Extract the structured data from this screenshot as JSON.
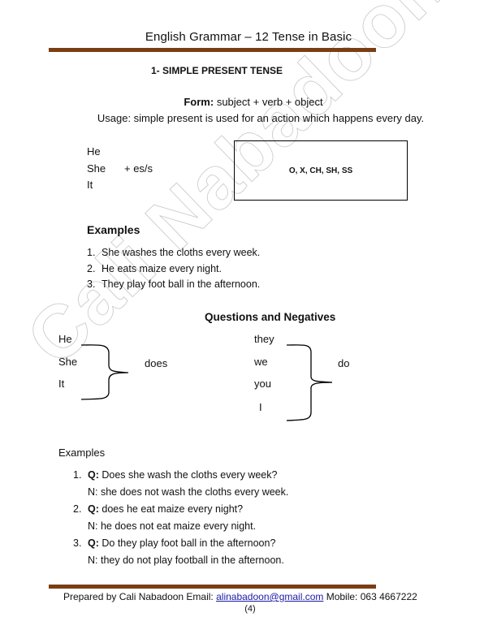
{
  "header": {
    "title": "English Grammar – 12 Tense in Basic"
  },
  "section": {
    "title": "1- SIMPLE PRESENT TENSE",
    "form_label": "Form:",
    "form_text": " subject + verb + object",
    "usage_text": "Usage: simple present is used for an action which happens every day."
  },
  "rule": {
    "pronouns": [
      "He",
      "She",
      "It"
    ],
    "suffix": "+ es/s",
    "endings_box": "O, X, CH, SH, SS"
  },
  "examples": {
    "heading": "Examples",
    "items": [
      {
        "num": "1.",
        "text": "She washes the cloths every week."
      },
      {
        "num": "2.",
        "text": "He eats maize every night."
      },
      {
        "num": "3.",
        "text": "They play foot ball in the afternoon."
      }
    ]
  },
  "questions_negatives": {
    "heading": "Questions and Negatives",
    "group1_pronouns": [
      "He",
      "She",
      "It"
    ],
    "group1_aux": "does",
    "group2_pronouns": [
      "they",
      "we",
      "you",
      "I"
    ],
    "group2_aux": "do"
  },
  "qn_examples": {
    "heading": "Examples",
    "items": [
      {
        "num": "1.",
        "q_label": "Q:",
        "q_text": " Does she wash the cloths every week?",
        "n_text": "N: she does not wash the cloths every week."
      },
      {
        "num": "2.",
        "q_label": "Q:",
        "q_text": " does he eat maize every night?",
        "n_text": "N: he does not eat maize every night."
      },
      {
        "num": "3.",
        "q_label": "Q:",
        "q_text": " Do they play foot ball in the afternoon?",
        "n_text": "N: they do not play football in the afternoon."
      }
    ]
  },
  "watermark": {
    "text": "Cali Nabadoon"
  },
  "footer": {
    "prepared_by": "Prepared by Cali Nabadoon Email: ",
    "email": "alinabadoon@gmail.com",
    "mobile": " Mobile: 063  4667222",
    "page_number": "(4)"
  },
  "colors": {
    "rule": "#7a3e12",
    "link": "#1a1aa6"
  }
}
